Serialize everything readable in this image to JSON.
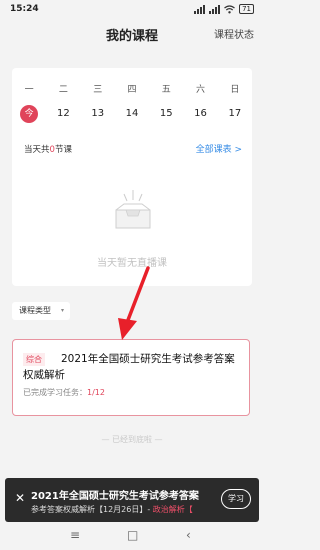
{
  "status_bar": {
    "time": "15:24",
    "battery": "71"
  },
  "header": {
    "title": "我的课程",
    "right_link": "课程状态"
  },
  "calendar": {
    "weekdays": [
      "一",
      "二",
      "三",
      "四",
      "五",
      "六",
      "日"
    ],
    "today_label": "今",
    "dates": [
      "12",
      "13",
      "14",
      "15",
      "16",
      "17"
    ],
    "summary_prefix": "当天共",
    "summary_count": "0",
    "summary_suffix": "节课",
    "all_schedule": "全部课表",
    "all_schedule_chevron": ">",
    "empty_text": "当天暂无直播课"
  },
  "filter": {
    "label": "课程类型",
    "arrow": "▾"
  },
  "course": {
    "tag": "综合",
    "title": "2021年全国硕士研究生考试参考答案权威解析",
    "progress_label": "已完成学习任务：",
    "progress_value": "1/12"
  },
  "end_text": "— 已经到底啦 —",
  "banner": {
    "close": "✕",
    "title": "2021年全国硕士研究生考试参考答案",
    "subtitle_prefix": "参考答案权威解析【12月26日】- ",
    "subtitle_highlight": "政治解析【",
    "button": "学习"
  },
  "nav": {
    "menu": "≡",
    "home": "□",
    "back": "‹"
  },
  "colors": {
    "accent": "#e0445a",
    "link": "#3a8ee6",
    "annotation": "#e8202a"
  }
}
